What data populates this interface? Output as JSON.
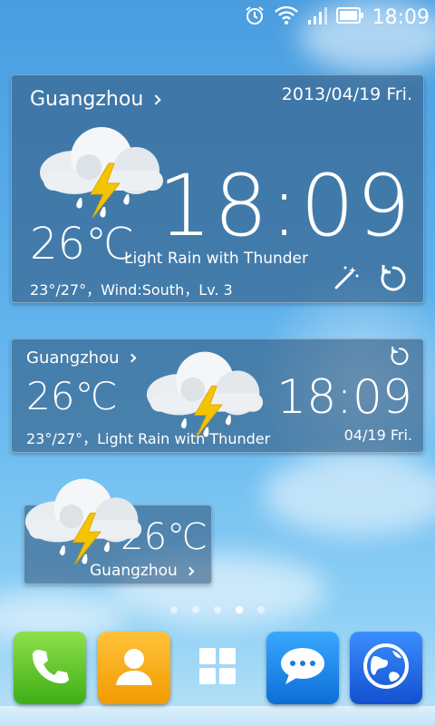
{
  "status_bar": {
    "time": "18:09",
    "icons": [
      "alarm-icon",
      "wifi-icon",
      "signal-icon",
      "battery-icon"
    ]
  },
  "widget_large": {
    "city": "Guangzhou",
    "date": "2013/04/19  Fri.",
    "time": "18:09",
    "temperature": "26℃",
    "condition": "Light Rain with Thunder",
    "detail": "23°/27°，Wind:South，Lv. 3",
    "weather_icon": "thunder-rain-cloud-icon"
  },
  "widget_medium": {
    "city": "Guangzhou",
    "temperature": "26℃",
    "time": "18:09",
    "detail": "23°/27°，Light Rain with Thunder",
    "date": "04/19 Fri.",
    "weather_icon": "thunder-rain-cloud-icon"
  },
  "widget_small": {
    "temperature": "26℃",
    "city": "Guangzhou",
    "weather_icon": "thunder-rain-cloud-icon"
  },
  "page_indicator": {
    "count": 5,
    "active_index": 3
  },
  "dock": {
    "apps": [
      "phone-icon",
      "contacts-icon",
      "app-drawer-icon",
      "messages-icon",
      "browser-icon"
    ]
  },
  "colors": {
    "widget_bg": "#345c82",
    "sky": "#5aaeea",
    "bolt": "#f5c400",
    "phone_app": "#3fae17",
    "contacts_app": "#f29a00",
    "messages_app": "#0c6ed8",
    "browser_app": "#1350d0"
  }
}
